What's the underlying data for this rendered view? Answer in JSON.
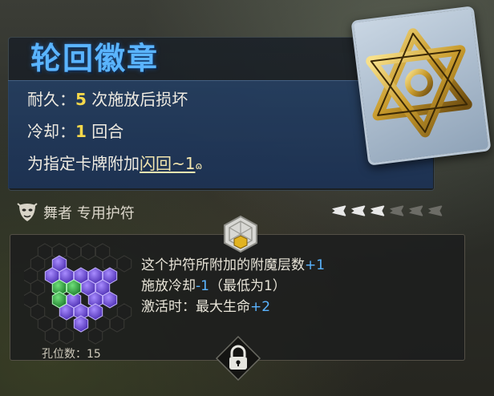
{
  "card": {
    "title": "轮回徽章",
    "durability_label": "耐久：",
    "durability_value": "5",
    "durability_suffix": " 次施放后损坏",
    "cooldown_label": "冷却：",
    "cooldown_value": "1",
    "cooldown_suffix": " 回合",
    "effect_prefix": "为指定卡牌附加",
    "effect_keyword": "闪回~1",
    "owner_text": "舞者 专用护符",
    "charges_total": 6,
    "charges_active": 3
  },
  "socket": {
    "effects": [
      {
        "text": "这个护符所附加的附魔层数",
        "value": "+1",
        "tail": ""
      },
      {
        "text": "施放冷却",
        "value": "-1",
        "tail": "（最低为1）"
      },
      {
        "text": "激活时：最大生命",
        "value": "+2",
        "tail": ""
      }
    ],
    "slot_count_label": "孔位数：",
    "slot_count_value": "15"
  },
  "colors": {
    "title_blue": "#5ab4ff",
    "highlight_yellow": "#f6d84a",
    "gem_purple": "#6a4cd8",
    "gem_green": "#3aa84a"
  },
  "icons": {
    "card_art": "golden-interlaced-star-icon",
    "owner": "dancer-mask-icon",
    "charge": "wing-charge-icon",
    "gem_badge": "gem-cube-icon",
    "lock": "lock-icon"
  }
}
